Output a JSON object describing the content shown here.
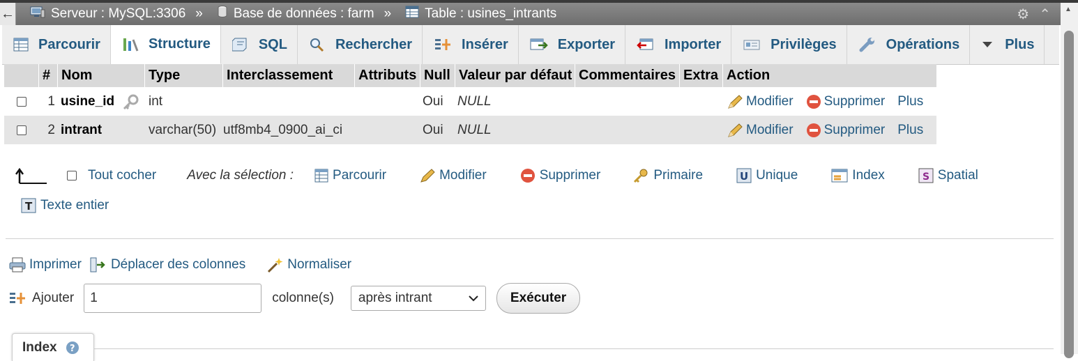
{
  "breadcrumb": {
    "back_glyph": "←",
    "server": "Serveur : MySQL:3306",
    "sep1": "»",
    "database": "Base de données : farm",
    "sep2": "»",
    "table": "Table : usines_intrants"
  },
  "tabs": [
    {
      "label": "Parcourir",
      "icon": "browse-icon"
    },
    {
      "label": "Structure",
      "icon": "structure-icon",
      "active": true
    },
    {
      "label": "SQL",
      "icon": "sql-icon"
    },
    {
      "label": "Rechercher",
      "icon": "search-icon"
    },
    {
      "label": "Insérer",
      "icon": "insert-icon"
    },
    {
      "label": "Exporter",
      "icon": "export-icon"
    },
    {
      "label": "Importer",
      "icon": "import-icon"
    },
    {
      "label": "Privilèges",
      "icon": "privileges-icon"
    },
    {
      "label": "Opérations",
      "icon": "wrench-icon"
    },
    {
      "label": "Plus",
      "icon": "chevron-down-icon"
    }
  ],
  "table": {
    "headers": [
      "#",
      "Nom",
      "Type",
      "Interclassement",
      "Attributs",
      "Null",
      "Valeur par défaut",
      "Commentaires",
      "Extra",
      "Action"
    ],
    "rows": [
      {
        "num": "1",
        "name": "usine_id",
        "type": "int",
        "collation": "",
        "attributes": "",
        "null": "Oui",
        "default": "NULL",
        "comments": "",
        "extra": "",
        "primary_key": true
      },
      {
        "num": "2",
        "name": "intrant",
        "type": "varchar(50)",
        "collation": "utf8mb4_0900_ai_ci",
        "attributes": "",
        "null": "Oui",
        "default": "NULL",
        "comments": "",
        "extra": ""
      }
    ],
    "actions": {
      "edit": "Modifier",
      "delete": "Supprimer",
      "more": "Plus"
    }
  },
  "selection": {
    "check_all": "Tout cocher",
    "with_selected": "Avec la sélection :",
    "items": [
      "Parcourir",
      "Modifier",
      "Supprimer",
      "Primaire",
      "Unique",
      "Index",
      "Spatial",
      "Texte entier"
    ]
  },
  "tools": {
    "print": "Imprimer",
    "move_columns": "Déplacer des colonnes",
    "normalize": "Normaliser"
  },
  "add_columns": {
    "label": "Ajouter",
    "count_value": "1",
    "suffix": "colonne(s)",
    "position_selected": "après intrant",
    "submit": "Exécuter"
  },
  "index_section": {
    "title": "Index"
  },
  "colors": {
    "link": "#235a81",
    "header_bg": "#d9d9d9",
    "topbar": "#7a7a7a",
    "row_alt": "#e5e5e5"
  }
}
